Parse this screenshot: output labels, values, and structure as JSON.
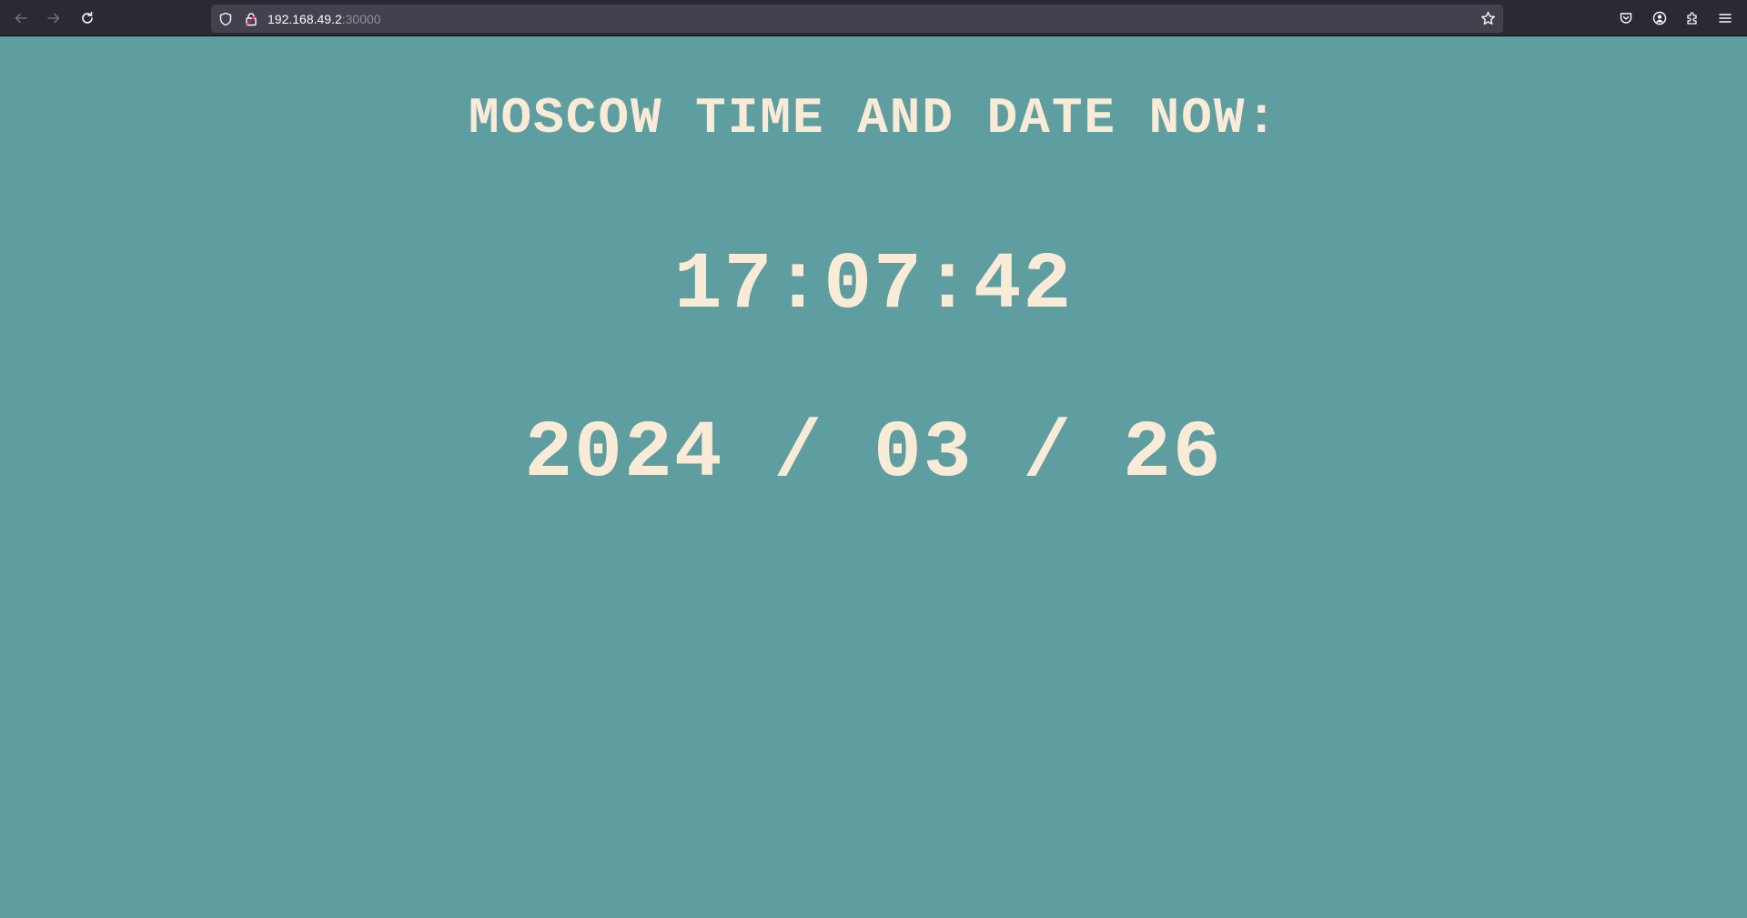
{
  "browser": {
    "url_host": "192.168.49.2",
    "url_port": ":30000",
    "icons": {
      "back": "arrow-left-icon",
      "forward": "arrow-right-icon",
      "reload": "reload-icon",
      "shield": "shield-icon",
      "lock": "lock-icon",
      "bookmark": "star-icon",
      "pocket": "pocket-icon",
      "account": "account-icon",
      "extensions": "puzzle-icon",
      "menu": "hamburger-menu-icon"
    }
  },
  "page": {
    "title": "MOSCOW TIME AND DATE NOW:",
    "time": "17:07:42",
    "date": "2024 / 03 / 26"
  },
  "colors": {
    "background": "#5f9ea0",
    "text": "#faebd7",
    "toolbar": "#2b2a33",
    "urlbar": "#42414d"
  }
}
